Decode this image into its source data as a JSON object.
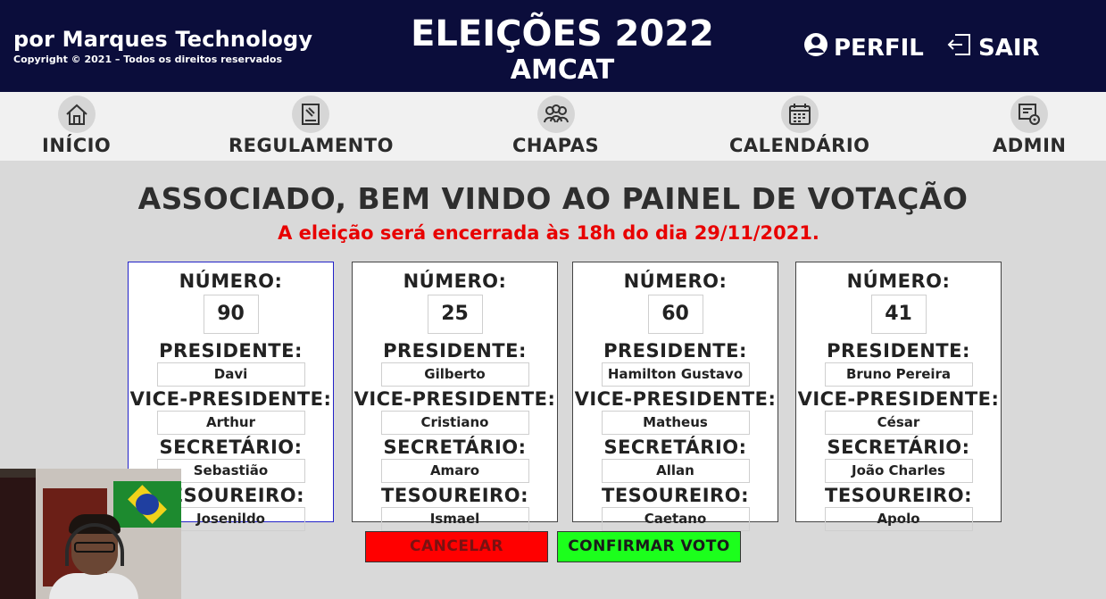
{
  "header": {
    "brand": "por Marques Technology",
    "copyright": "Copyright © 2021 – Todos os direitos reservados",
    "title": "ELEIÇÕES 2022",
    "subtitle": "AMCAT",
    "profile_label": "PERFIL",
    "logout_label": "SAIR"
  },
  "nav": {
    "items": [
      {
        "label": "INÍCIO",
        "icon": "home-icon"
      },
      {
        "label": "REGULAMENTO",
        "icon": "document-icon"
      },
      {
        "label": "CHAPAS",
        "icon": "group-icon"
      },
      {
        "label": "CALENDÁRIO",
        "icon": "calendar-icon"
      },
      {
        "label": "ADMIN",
        "icon": "admin-settings-icon"
      }
    ]
  },
  "main": {
    "welcome": "ASSOCIADO, BEM VINDO AO PAINEL DE VOTAÇÃO",
    "notice": "A eleição será encerrada às 18h do dia 29/11/2021.",
    "notice_color": "#e80000"
  },
  "labels": {
    "number": "NÚMERO:",
    "president": "PRESIDENTE:",
    "vice": "VICE-PRESIDENTE:",
    "secretary": "SECRETÁRIO:",
    "treasurer": "TESOUREIRO:"
  },
  "slates": [
    {
      "number": "90",
      "president": "Davi",
      "vice": "Arthur",
      "secretary": "Sebastião",
      "treasurer": "Josenildo"
    },
    {
      "number": "25",
      "president": "Gilberto",
      "vice": "Cristiano",
      "secretary": "Amaro",
      "treasurer": "Ismael"
    },
    {
      "number": "60",
      "president": "Hamilton Gustavo",
      "vice": "Matheus",
      "secretary": "Allan",
      "treasurer": "Caetano"
    },
    {
      "number": "41",
      "president": "Bruno Pereira",
      "vice": "César",
      "secretary": "João Charles",
      "treasurer": "Apolo"
    }
  ],
  "actions": {
    "cancel": "CANCELAR",
    "confirm": "CONFIRMAR VOTO",
    "cancel_color": "#ff0000",
    "confirm_color": "#1cff1c"
  },
  "colors": {
    "header_bg": "#0b0d3b",
    "nav_bg": "#f1f1f1",
    "page_bg": "#d9d9d9",
    "selected_border": "#2222c8"
  }
}
